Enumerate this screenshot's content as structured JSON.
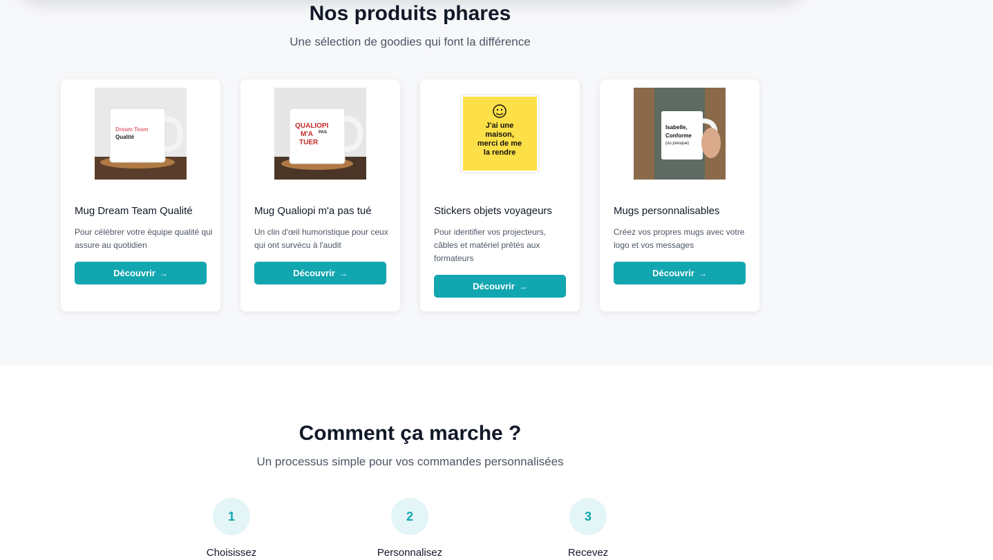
{
  "products": {
    "title": "Nos produits phares",
    "subtitle": "Une sélection de goodies qui font la différence",
    "items": [
      {
        "name": "Mug Dream Team Qualité",
        "description": "Pour célébrer votre équipe qualité qui assure au quotidien",
        "button": "Découvrir",
        "image_text": [
          "Dream Team",
          "Qualité"
        ]
      },
      {
        "name": "Mug Qualiopi m'a pas tué",
        "description": "Un clin d'œil humoristique pour ceux qui ont survécu à l'audit",
        "button": "Découvrir",
        "image_text": [
          "QUALIOPI",
          "M'A",
          "PAS",
          "TUER"
        ]
      },
      {
        "name": "Stickers objets voyageurs",
        "description": "Pour identifier vos projecteurs, câbles et matériel prêtés aux formateurs",
        "button": "Découvrir",
        "image_text": [
          "J'ai une",
          "maison,",
          "merci de me",
          "la rendre"
        ]
      },
      {
        "name": "Mugs personnalisables",
        "description": "Créez vos propres mugs avec votre logo et vos messages",
        "button": "Découvrir",
        "image_text": [
          "Isabelle,",
          "Conforme",
          "(ou presque)"
        ]
      }
    ]
  },
  "process": {
    "title": "Comment ça marche ?",
    "subtitle": "Un processus simple pour vos commandes personnalisées",
    "steps": [
      {
        "number": "1",
        "label": "Choisissez"
      },
      {
        "number": "2",
        "label": "Personnalisez"
      },
      {
        "number": "3",
        "label": "Recevez"
      }
    ]
  },
  "colors": {
    "accent": "#12a6b0",
    "section_bg": "#f7f8fa",
    "step_bg": "#e3f5f6"
  }
}
